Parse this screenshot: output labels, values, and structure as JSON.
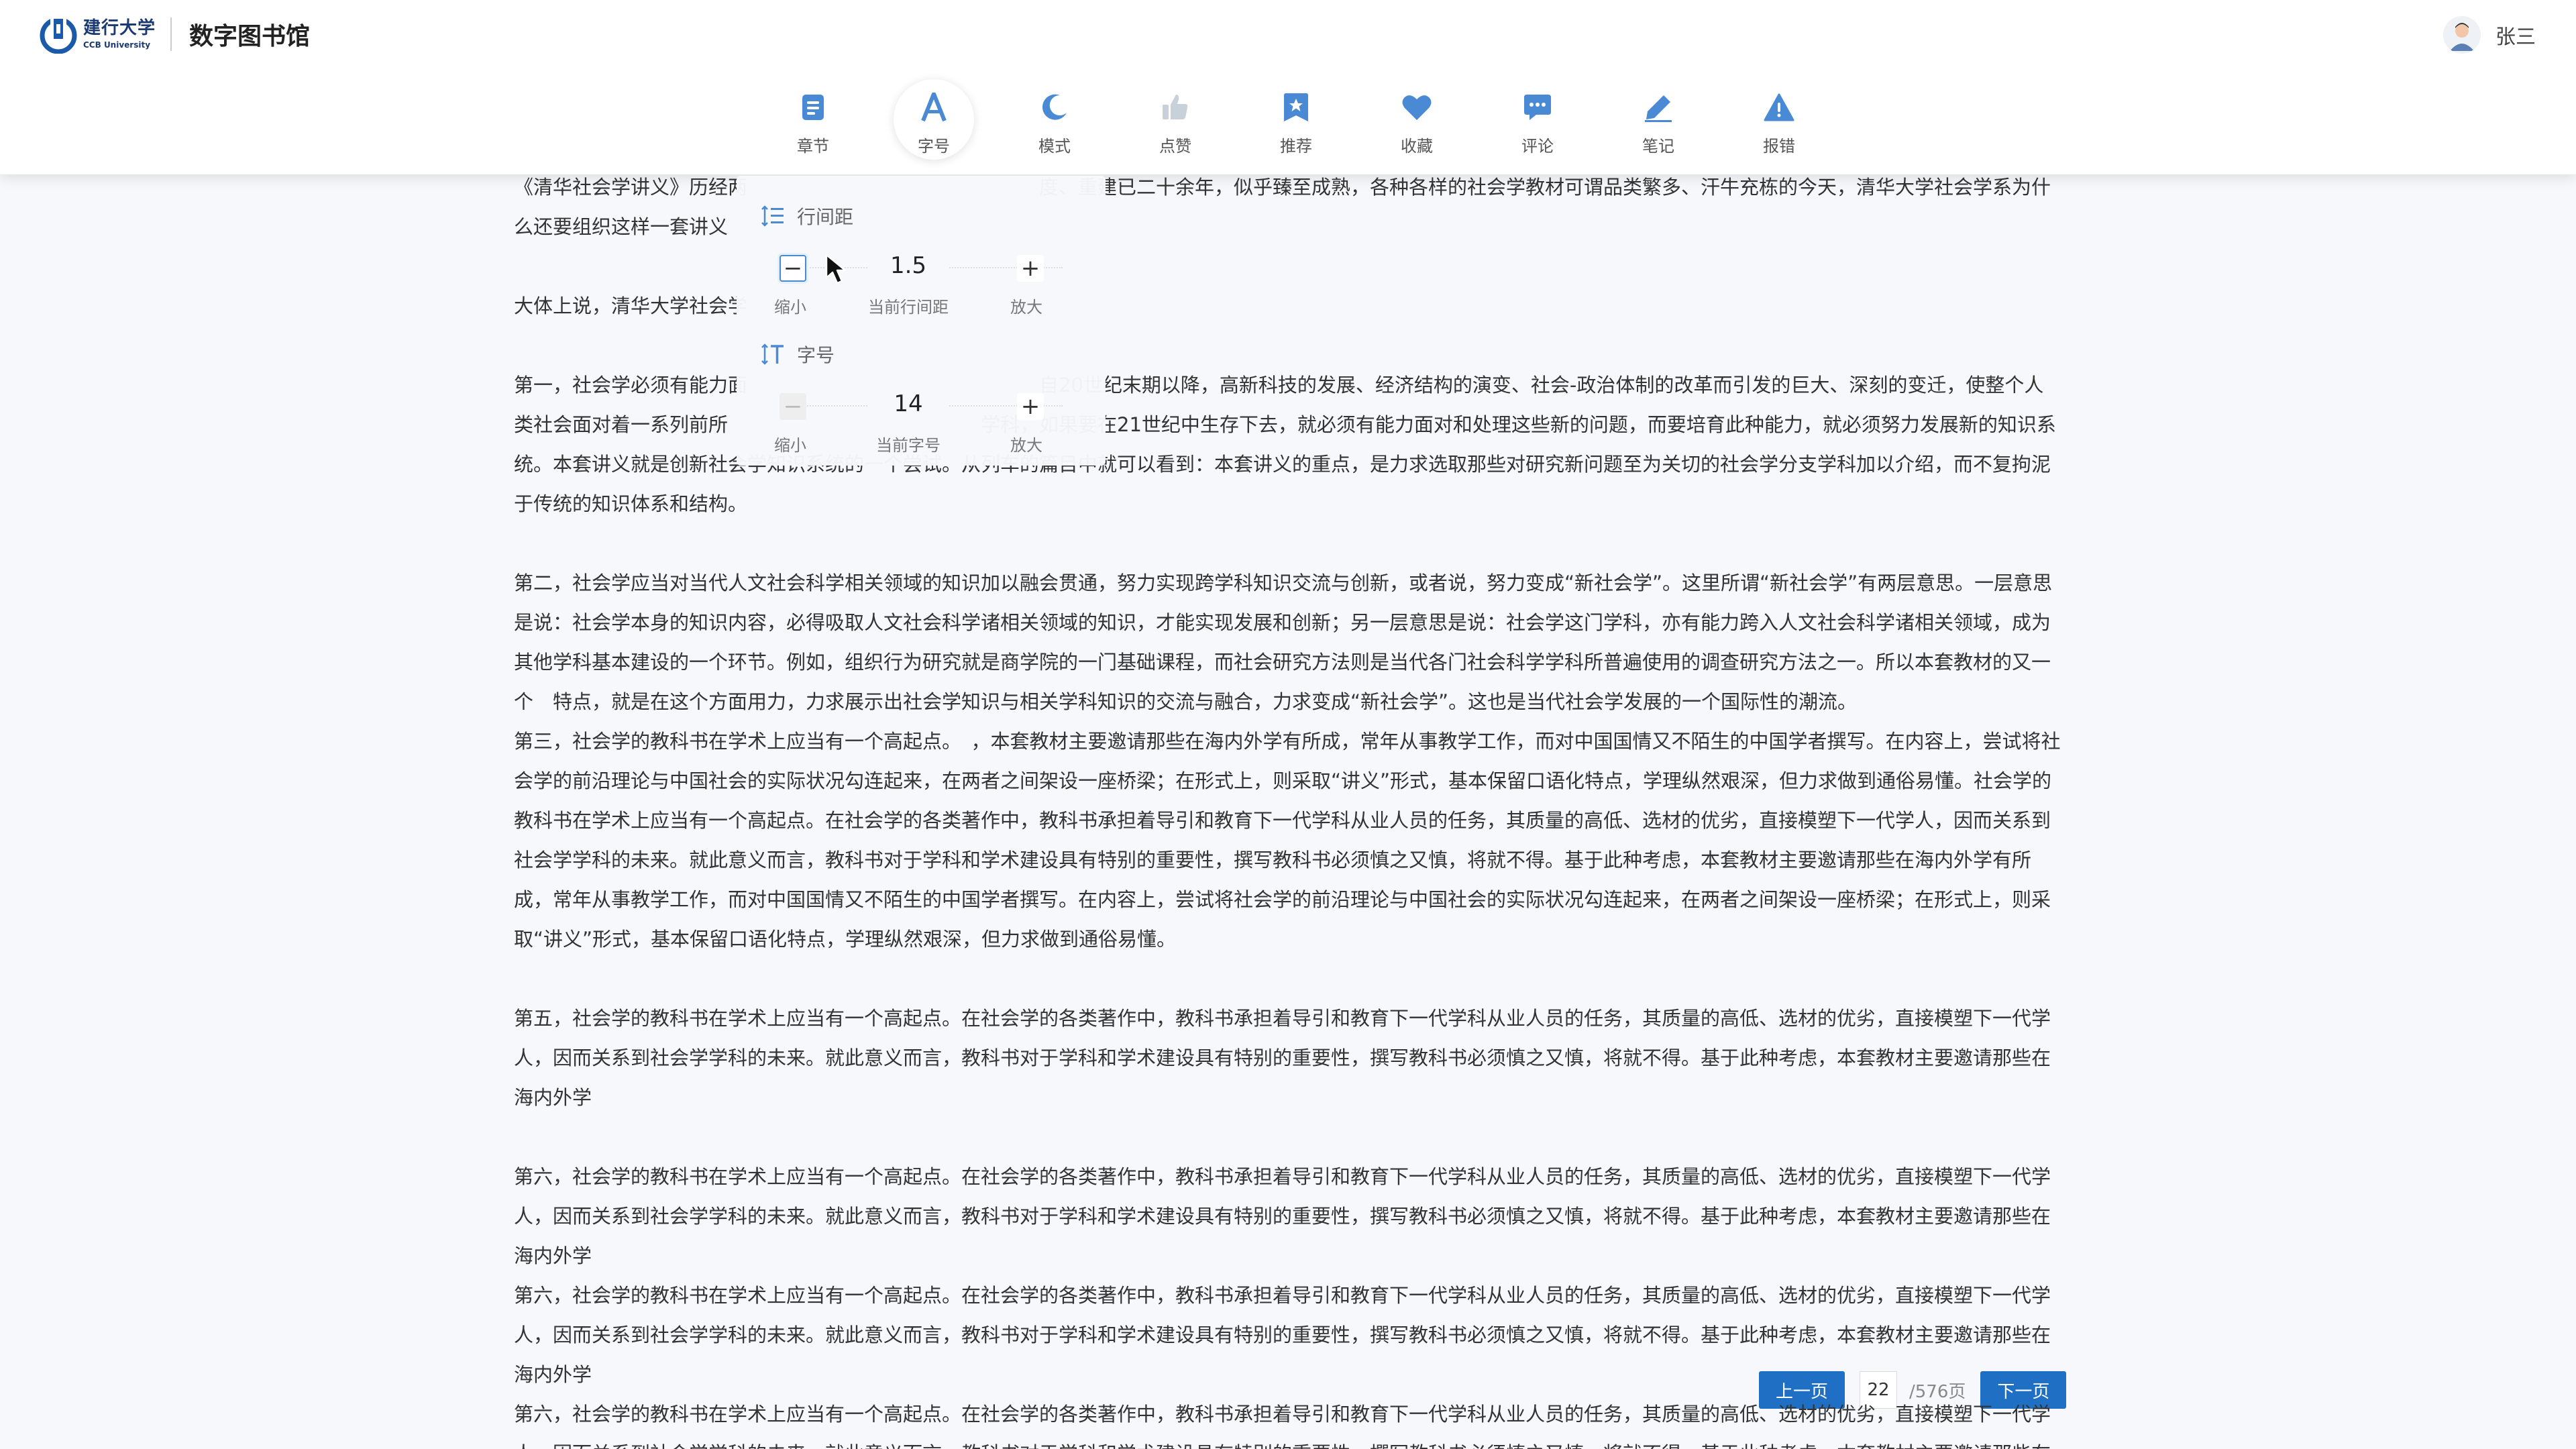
{
  "header": {
    "logo_cn": "建行大学",
    "logo_en": "CCB University",
    "site_title": "数字图书馆",
    "user_name": "张三"
  },
  "toolbar": {
    "active": "字号",
    "items": [
      {
        "label": "章节",
        "icon": "chapter-icon"
      },
      {
        "label": "字号",
        "icon": "font-size-icon"
      },
      {
        "label": "模式",
        "icon": "moon-icon"
      },
      {
        "label": "点赞",
        "icon": "thumbs-up-icon"
      },
      {
        "label": "推荐",
        "icon": "recommend-icon"
      },
      {
        "label": "收藏",
        "icon": "heart-icon"
      },
      {
        "label": "评论",
        "icon": "comment-icon"
      },
      {
        "label": "笔记",
        "icon": "pencil-icon"
      },
      {
        "label": "报错",
        "icon": "warning-icon"
      }
    ]
  },
  "popover": {
    "line_spacing": {
      "title": "行间距",
      "value": "1.5",
      "minus_label": "缩小",
      "current_label": "当前行间距",
      "plus_label": "放大"
    },
    "font_size": {
      "title": "字号",
      "value": "14",
      "minus_label": "缩小",
      "current_label": "当前字号",
      "plus_label": "放大"
    }
  },
  "article": {
    "paragraphs": [
      {
        "gap": false,
        "text": "《清华社会学讲义》历经两　　　　　　　　　　　　　　　度、重建已二十余年，似乎臻至成熟，各种各样的社会学教材可谓品类繁多、汗牛充栋的今天，清华大学社会学系为什么还要组织这样一套讲义"
      },
      {
        "gap": true,
        "text": "大体上说，清华大学社会学"
      },
      {
        "gap": true,
        "text": "第一，社会学必须有能力面　　　　　　　　　　　　　　　自20世纪末期以降，高新科技的发展、经济结构的演变、社会-政治体制的改革而引发的巨大、深刻的变迁，使整个人类社会面对着一系列前所　　　　　　　　　　　　　学科，如果要在21世纪中生存下去，就必须有能力面对和处理这些新的问题，而要培育此种能力，就必须努力发展新的知识系统。本套讲义就是创新社会学知识系统的一个尝试。从列车的篇目中就可以看到：本套讲义的重点，是力求选取那些对研究新问题至为关切的社会学分支学科加以介绍，而不复拘泥于传统的知识体系和结构。"
      },
      {
        "gap": true,
        "text": "第二，社会学应当对当代人文社会科学相关领域的知识加以融会贯通，努力实现跨学科知识交流与创新，或者说，努力变成“新社会学”。这里所谓“新社会学”有两层意思。一层意思是说：社会学本身的知识内容，必得吸取人文社会科学诸相关领域的知识，才能实现发展和创新；另一层意思是说：社会学这门学科，亦有能力跨入人文社会科学诸相关领域，成为其他学科基本建设的一个环节。例如，组织行为研究就是商学院的一门基础课程，而社会研究方法则是当代各门社会科学学科所普遍使用的调查研究方法之一。所以本套教材的又一个　特点，就是在这个方面用力，力求展示出社会学知识与相关学科知识的交流与融合，力求变成“新社会学”。这也是当代社会学发展的一个国际性的潮流。"
      },
      {
        "gap": false,
        "text": "第三，社会学的教科书在学术上应当有一个高起点。　，本套教材主要邀请那些在海内外学有所成，常年从事教学工作，而对中国国情又不陌生的中国学者撰写。在内容上，尝试将社会学的前沿理论与中国社会的实际状况勾连起来，在两者之间架设一座桥梁；在形式上，则采取“讲义”形式，基本保留口语化特点，学理纵然艰深，但力求做到通俗易懂。社会学的教科书在学术上应当有一个高起点。在社会学的各类著作中，教科书承担着导引和教育下一代学科从业人员的任务，其质量的高低、选材的优劣，直接模塑下一代学人，因而关系到社会学学科的未来。就此意义而言，教科书对于学科和学术建设具有特别的重要性，撰写教科书必须慎之又慎，将就不得。基于此种考虑，本套教材主要邀请那些在海内外学有所成，常年从事教学工作，而对中国国情又不陌生的中国学者撰写。在内容上，尝试将社会学的前沿理论与中国社会的实际状况勾连起来，在两者之间架设一座桥梁；在形式上，则采取“讲义”形式，基本保留口语化特点，学理纵然艰深，但力求做到通俗易懂。"
      },
      {
        "gap": true,
        "text": "第五，社会学的教科书在学术上应当有一个高起点。在社会学的各类著作中，教科书承担着导引和教育下一代学科从业人员的任务，其质量的高低、选材的优劣，直接模塑下一代学人，因而关系到社会学学科的未来。就此意义而言，教科书对于学科和学术建设具有特别的重要性，撰写教科书必须慎之又慎，将就不得。基于此种考虑，本套教材主要邀请那些在海内外学"
      },
      {
        "gap": true,
        "text": "第六，社会学的教科书在学术上应当有一个高起点。在社会学的各类著作中，教科书承担着导引和教育下一代学科从业人员的任务，其质量的高低、选材的优劣，直接模塑下一代学人，因而关系到社会学学科的未来。就此意义而言，教科书对于学科和学术建设具有特别的重要性，撰写教科书必须慎之又慎，将就不得。基于此种考虑，本套教材主要邀请那些在海内外学"
      },
      {
        "gap": false,
        "text": "第六，社会学的教科书在学术上应当有一个高起点。在社会学的各类著作中，教科书承担着导引和教育下一代学科从业人员的任务，其质量的高低、选材的优劣，直接模塑下一代学人，因而关系到社会学学科的未来。就此意义而言，教科书对于学科和学术建设具有特别的重要性，撰写教科书必须慎之又慎，将就不得。基于此种考虑，本套教材主要邀请那些在海内外学"
      },
      {
        "gap": false,
        "text": "第六，社会学的教科书在学术上应当有一个高起点。在社会学的各类著作中，教科书承担着导引和教育下一代学科从业人员的任务，其质量的高低、选材的优劣，直接模塑下一代学人，因而关系到社会学学科的未来。就此意义而言，教科书对于学科和学术建设具有特别的重要性，撰写教科书必须慎之又慎，将就不得。基于此种考虑，本套教材主要邀请那些在海内外学"
      }
    ]
  },
  "pagination": {
    "prev_label": "上一页",
    "current_page": "22",
    "total_label": "/576页",
    "next_label": "下一页"
  },
  "colors": {
    "accent": "#1f6fc5",
    "icon_blue": "#4a8ad4",
    "icon_disabled": "#c8d0da",
    "brand_navy": "#1b3a72"
  }
}
